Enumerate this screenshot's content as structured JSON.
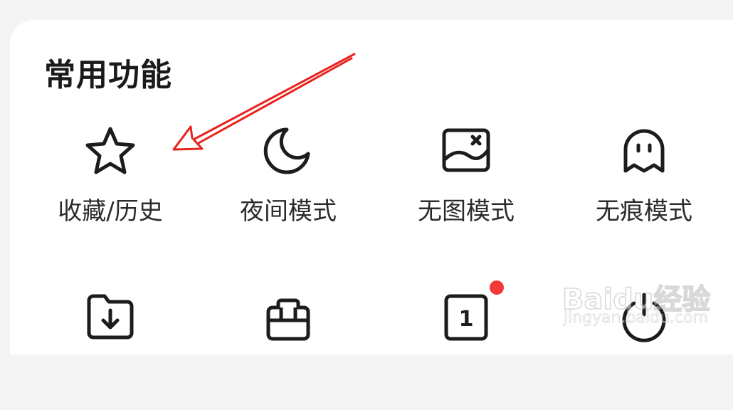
{
  "section": {
    "title": "常用功能"
  },
  "features": [
    {
      "label": "收藏/历史",
      "icon": "star-icon"
    },
    {
      "label": "夜间模式",
      "icon": "moon-icon"
    },
    {
      "label": "无图模式",
      "icon": "no-image-icon"
    },
    {
      "label": "无痕模式",
      "icon": "ghost-icon"
    },
    {
      "label": "",
      "icon": "download-folder-icon"
    },
    {
      "label": "",
      "icon": "toolbox-icon"
    },
    {
      "label": "",
      "icon": "tab-count-icon",
      "count": "1",
      "badge_color": "#f23a3a"
    },
    {
      "label": "",
      "icon": "power-icon"
    }
  ],
  "annotation": {
    "arrow_color": "#e8231e"
  },
  "watermark": {
    "main": "Baidu经验",
    "sub": "jingyan.baidu.com"
  }
}
